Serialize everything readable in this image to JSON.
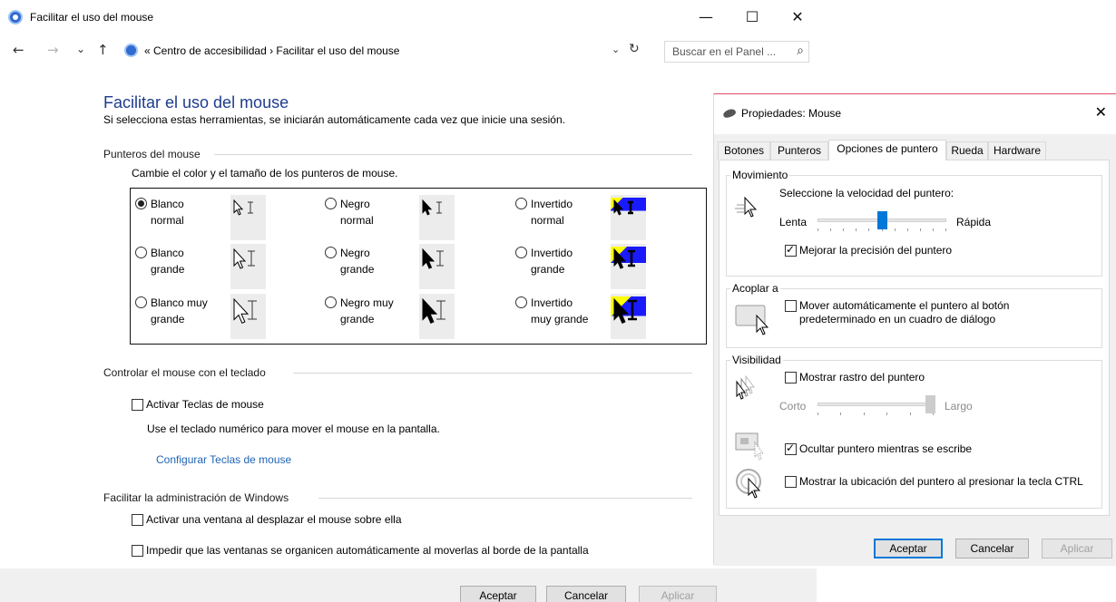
{
  "window": {
    "title": "Facilitar el uso del mouse",
    "minimize": "—",
    "maximize": "☐",
    "close": "✕"
  },
  "nav": {
    "back": "←",
    "forward": "→",
    "recent": "⌄",
    "up": "↑",
    "breadcrumb": "« Centro de accesibilidad  ›  Facilitar el uso del mouse",
    "dropdown": "⌄",
    "refresh": "↻",
    "search_placeholder": "Buscar en el Panel ...",
    "search_icon": "⌕"
  },
  "page": {
    "title": "Facilitar el uso del mouse",
    "subtitle": "Si selecciona estas herramientas, se iniciarán automáticamente cada vez que inicie una sesión."
  },
  "pointers": {
    "heading": "Punteros del mouse",
    "instruction": "Cambie el color y el tamaño de los punteros de mouse.",
    "options": [
      {
        "label": "Blanco\nnormal",
        "selected": true,
        "style": "white",
        "size": "normal"
      },
      {
        "label": "Negro\nnormal",
        "selected": false,
        "style": "black",
        "size": "normal"
      },
      {
        "label": "Invertido\nnormal",
        "selected": false,
        "style": "inverted",
        "size": "normal"
      },
      {
        "label": "Blanco\ngrande",
        "selected": false,
        "style": "white",
        "size": "large"
      },
      {
        "label": "Negro\ngrande",
        "selected": false,
        "style": "black",
        "size": "large"
      },
      {
        "label": "Invertido\ngrande",
        "selected": false,
        "style": "inverted",
        "size": "large"
      },
      {
        "label": "Blanco muy\ngrande",
        "selected": false,
        "style": "white",
        "size": "xlarge"
      },
      {
        "label": "Negro muy\ngrande",
        "selected": false,
        "style": "black",
        "size": "xlarge"
      },
      {
        "label": "Invertido\nmuy grande",
        "selected": false,
        "style": "inverted",
        "size": "xlarge"
      }
    ]
  },
  "keyboard": {
    "heading": "Controlar el mouse con el teclado",
    "mouse_keys_label": "Activar Teclas de mouse",
    "mouse_keys_checked": false,
    "description": "Use el teclado numérico para mover el mouse en la pantalla.",
    "configure_link": "Configurar Teclas de mouse"
  },
  "windows_mgmt": {
    "heading": "Facilitar la administración de Windows",
    "hover_activate_label": "Activar una ventana al desplazar el mouse sobre ella",
    "hover_activate_checked": false,
    "prevent_snap_label": "Impedir que las ventanas se organicen automáticamente al moverlas al borde de la pantalla",
    "prevent_snap_checked": false
  },
  "footer": {
    "ok": "Aceptar",
    "cancel": "Cancelar",
    "apply": "Aplicar"
  },
  "dialog": {
    "title": "Propiedades: Mouse",
    "close": "✕",
    "tabs": [
      "Botones",
      "Punteros",
      "Opciones de puntero",
      "Rueda",
      "Hardware"
    ],
    "active_tab": "Opciones de puntero",
    "motion": {
      "title": "Movimiento",
      "speed_label": "Seleccione la velocidad del puntero:",
      "slow": "Lenta",
      "fast": "Rápida",
      "speed_value": 6,
      "speed_max": 11,
      "precision_label": "Mejorar la precisión del puntero",
      "precision_checked": true
    },
    "snap": {
      "title": "Acoplar a",
      "label": "Mover automáticamente el puntero al botón\npredeterminado en un cuadro de diálogo",
      "checked": false
    },
    "visibility": {
      "title": "Visibilidad",
      "trails_label": "Mostrar rastro del puntero",
      "trails_checked": false,
      "short": "Corto",
      "long": "Largo",
      "trail_value": 1.0,
      "hide_label": "Ocultar puntero mientras se escribe",
      "hide_checked": true,
      "ctrl_label": "Mostrar la ubicación del puntero al presionar la tecla CTRL",
      "ctrl_checked": false
    },
    "buttons": {
      "ok": "Aceptar",
      "cancel": "Cancelar",
      "apply": "Aplicar"
    }
  }
}
